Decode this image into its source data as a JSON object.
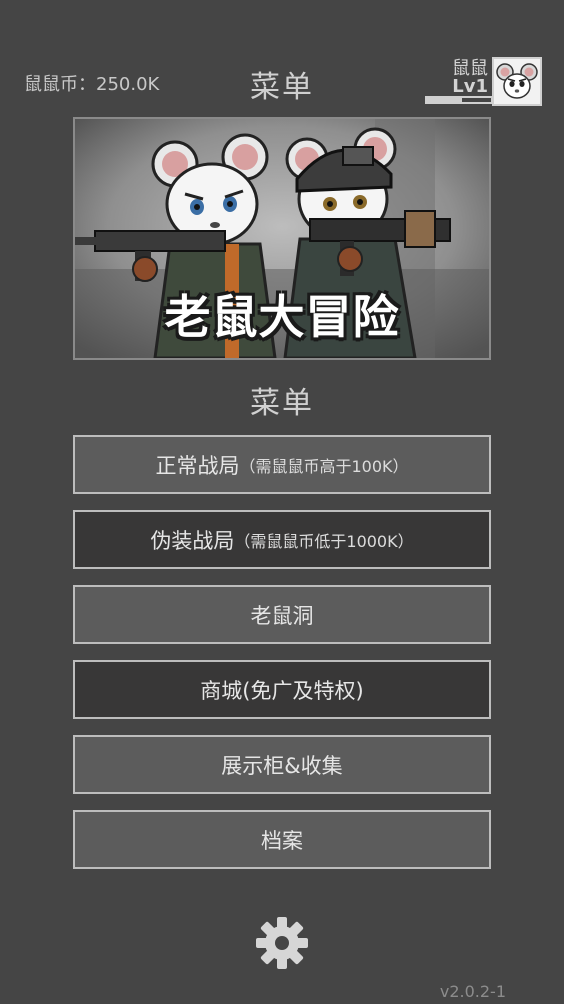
{
  "header": {
    "coins_label": "鼠鼠币：250.0K",
    "title": "菜单",
    "player_name": "鼠鼠",
    "player_level": "Lv1",
    "xp_progress": 0.55,
    "avatar_icon": "white-mouse-avatar-icon"
  },
  "banner": {
    "title": "老鼠大冒险"
  },
  "menu": {
    "title": "菜单",
    "buttons": [
      {
        "label": "正常战局",
        "note": "（需鼠鼠币高于100K）",
        "style": "light"
      },
      {
        "label": "伪装战局",
        "note": "（需鼠鼠币低于1000K）",
        "style": "dark"
      },
      {
        "label": "老鼠洞",
        "note": "",
        "style": "light"
      },
      {
        "label": "商城(免广及特权)",
        "note": "",
        "style": "dark"
      },
      {
        "label": "展示柜&收集",
        "note": "",
        "style": "light"
      },
      {
        "label": "档案",
        "note": "",
        "style": "light"
      }
    ]
  },
  "footer": {
    "settings_icon": "gear-icon",
    "version": "v2.0.2-1"
  },
  "colors": {
    "background": "#454545",
    "button_light": "#5c5c5c",
    "button_dark": "#383737",
    "border": "#bdbdbd",
    "text": "#e6e6e6"
  }
}
